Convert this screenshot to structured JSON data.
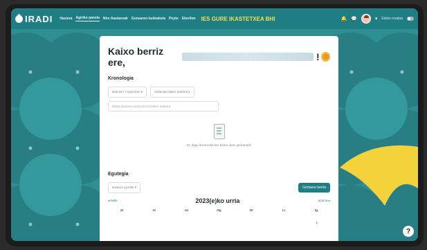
{
  "navbar": {
    "logo": "IRADI",
    "items": [
      {
        "label": "Hasiera"
      },
      {
        "label": "Agiriko panela",
        "active": true
      },
      {
        "label": "Nire ikastaroak"
      },
      {
        "label": "Gunearen kudeaketa"
      },
      {
        "label": "Poyto"
      },
      {
        "label": "Ekerilon"
      }
    ],
    "school": "IES GURE IKASTETXEA BHI",
    "edit_mode": "Edizio-modua"
  },
  "card": {
    "welcome_prefix": "Kaixo berriz ere,",
    "welcome_suffix": "!",
    "timeline": {
      "title": "Kronologia",
      "filter_days": "Datozen 7 egunetan",
      "filter_sort": "Ordenatu daten arabera",
      "search_placeholder": "Bilatu jarduera mota edo izenaren arabera",
      "empty_text": "Ez dago iksmizenik ber behar duen jarduerarik"
    },
    "calendar": {
      "title": "Egutegia",
      "course_select": "Ikastaro guztiak",
      "new_event": "Gertaera berria",
      "prev": "iraila",
      "next": "azaroa",
      "month": "2023(e)ko urria",
      "weekdays": [
        "Al",
        "Ar",
        "Az",
        "Og",
        "Or",
        "Lr",
        "Ig"
      ],
      "first_day": "1"
    }
  },
  "colors": {
    "brand": "#1f7d84",
    "background": "#2e8f92",
    "accent": "#f4e04d"
  }
}
